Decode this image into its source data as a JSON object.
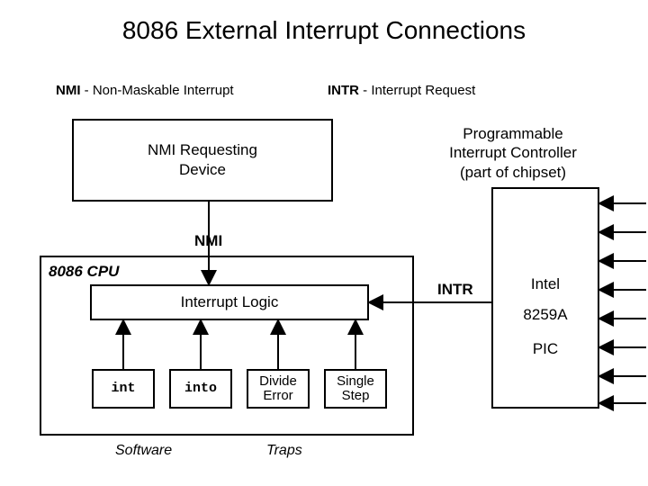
{
  "title": "8086 External Interrupt Connections",
  "defs": {
    "nmi_abbr": "NMI",
    "nmi_sep": " -  ",
    "nmi_full": "Non-Maskable Interrupt",
    "intr_abbr": "INTR",
    "intr_sep": " - ",
    "intr_full": "Interrupt Request"
  },
  "boxes": {
    "nmi_device_l1": "NMI Requesting",
    "nmi_device_l2": "Device",
    "pic_title_l1": "Programmable",
    "pic_title_l2": "Interrupt Controller",
    "pic_title_l3": "(part of chipset)",
    "pic_l1": "Intel",
    "pic_l2": "8259A",
    "pic_l3": "PIC",
    "cpu": "8086 CPU",
    "interrupt_logic": "Interrupt Logic",
    "int": "int",
    "into": "into",
    "divide_l1": "Divide",
    "divide_l2": "Error",
    "single_l1": "Single",
    "single_l2": "Step"
  },
  "signals": {
    "nmi": "NMI",
    "intr": "INTR"
  },
  "categories": {
    "software": "Software",
    "traps": "Traps"
  }
}
